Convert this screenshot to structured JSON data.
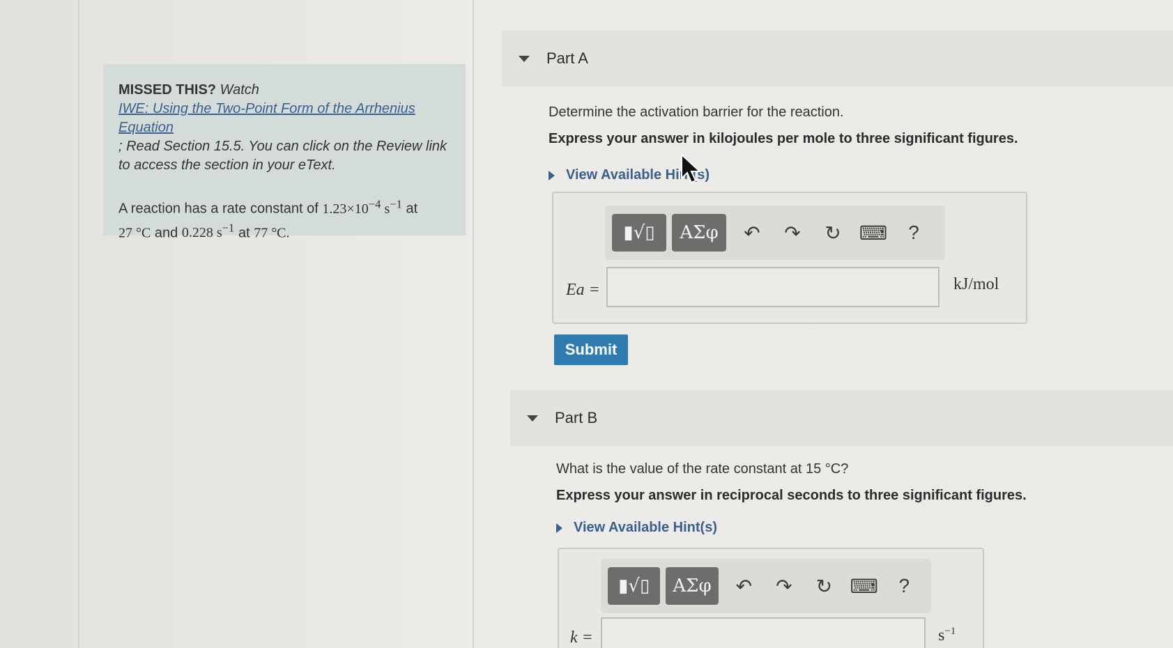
{
  "left_panel": {
    "missed_label": "MISSED THIS?",
    "watch_label": "Watch",
    "video_link": "IWE: Using the Two-Point Form of the Arrhenius Equation",
    "read_text": "; Read Section 15.5. You can click on the Review link to access the section in your eText.",
    "problem_prefix": "A reaction has a rate constant of",
    "k1_mantissa": "1.23×10",
    "k1_exponent": "−4",
    "k1_unit": "s",
    "k1_unit_exp": "−1",
    "at1": "at",
    "t1": "27 °C",
    "and": "and",
    "k2": "0.228",
    "k2_unit": "s",
    "k2_unit_exp": "−1",
    "at2": "at",
    "t2": "77 °C."
  },
  "part_a": {
    "title": "Part A",
    "question": "Determine the activation barrier for the reaction.",
    "instruction": "Express your answer in kilojoules per mole to three significant figures.",
    "hint": "View Available Hint(s)",
    "var_label": "Ea =",
    "unit": "kJ/mol",
    "input_value": "",
    "submit": "Submit"
  },
  "part_b": {
    "title": "Part B",
    "question": "What is the value of the rate constant at 15 °C?",
    "instruction": "Express your answer in reciprocal seconds to three significant figures.",
    "hint": "View Available Hint(s)",
    "var_label": "k =",
    "unit_base": "s",
    "unit_exp": "−1",
    "input_value": ""
  },
  "toolbar": {
    "template_btn": "▮√▯",
    "greek_btn": "ΑΣφ",
    "undo": "↶",
    "redo": "↷",
    "reset": "↻",
    "keyboard": "⌨",
    "help": "?"
  }
}
